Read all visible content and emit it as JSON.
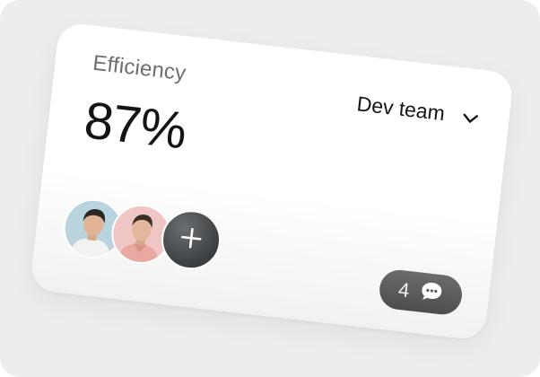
{
  "widget": {
    "title": "Efficiency",
    "value": "87%",
    "team_selector": {
      "selected": "Dev team"
    },
    "comments": {
      "count": "4"
    },
    "icons": {
      "dropdown": "chevron-down-icon",
      "add": "plus-icon",
      "comments": "chat-bubble-icon"
    },
    "colors": {
      "background": "#eceded",
      "card": "#ffffff",
      "text_primary": "#121417",
      "text_secondary": "#6b6e72",
      "pill": "#5a5c5e"
    }
  }
}
